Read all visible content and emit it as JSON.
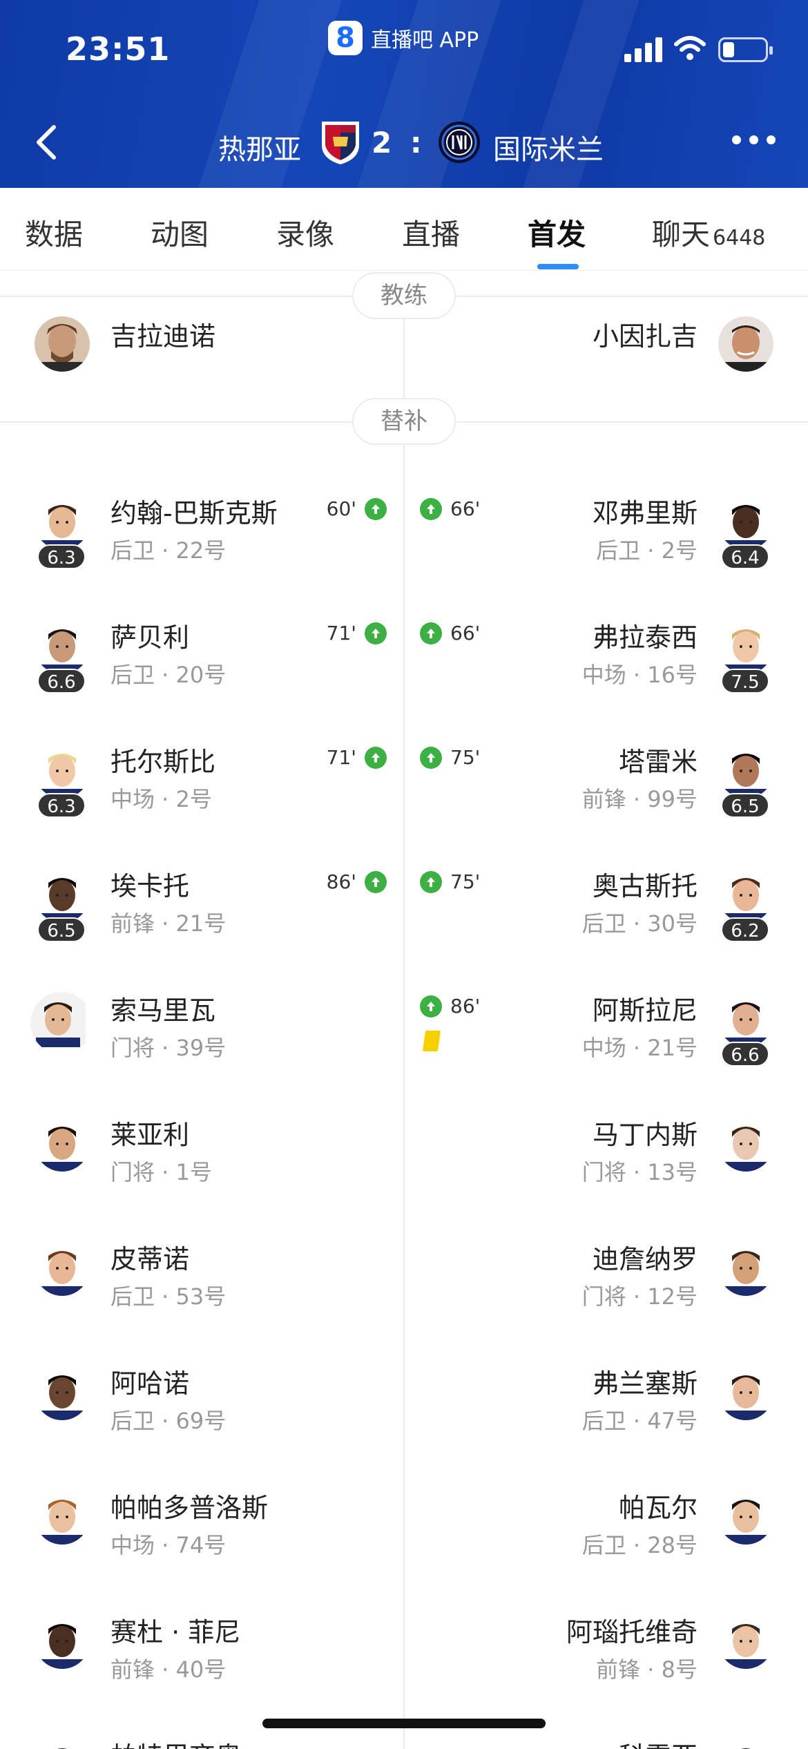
{
  "status_bar": {
    "time": "23:51",
    "app_name": "直播吧 APP",
    "app_logo_char": "8"
  },
  "match": {
    "home_team": "热那亚",
    "away_team": "国际米兰",
    "score": "2 : 2"
  },
  "tabs": [
    {
      "label": "数据"
    },
    {
      "label": "动图"
    },
    {
      "label": "录像"
    },
    {
      "label": "直播"
    },
    {
      "label": "首发",
      "active": true
    },
    {
      "label": "聊天",
      "count": "6448"
    }
  ],
  "sections": {
    "coach": "教练",
    "subs": "替补"
  },
  "coaches": {
    "home": "吉拉迪诺",
    "away": "小因扎吉"
  },
  "home_subs": [
    {
      "name": "约翰-巴斯克斯",
      "info": "后卫 · 22号",
      "rating": "6.3",
      "sub_time": "60'"
    },
    {
      "name": "萨贝利",
      "info": "后卫 · 20号",
      "rating": "6.6",
      "sub_time": "71'"
    },
    {
      "name": "托尔斯比",
      "info": "中场 · 2号",
      "rating": "6.3",
      "sub_time": "71'"
    },
    {
      "name": "埃卡托",
      "info": "前锋 · 21号",
      "rating": "6.5",
      "sub_time": "86'"
    },
    {
      "name": "索马里瓦",
      "info": "门将 · 39号"
    },
    {
      "name": "莱亚利",
      "info": "门将 · 1号"
    },
    {
      "name": "皮蒂诺",
      "info": "后卫 · 53号"
    },
    {
      "name": "阿哈诺",
      "info": "后卫 · 69号"
    },
    {
      "name": "帕帕多普洛斯",
      "info": "中场 · 74号"
    },
    {
      "name": "赛杜 · 菲尼",
      "info": "前锋 · 40号"
    },
    {
      "name": "帕特里齐奥"
    }
  ],
  "away_subs": [
    {
      "name": "邓弗里斯",
      "info": "后卫 · 2号",
      "rating": "6.4",
      "sub_time": "66'"
    },
    {
      "name": "弗拉泰西",
      "info": "中场 · 16号",
      "rating": "7.5",
      "sub_time": "66'"
    },
    {
      "name": "塔雷米",
      "info": "前锋 · 99号",
      "rating": "6.5",
      "sub_time": "75'"
    },
    {
      "name": "奥古斯托",
      "info": "后卫 · 30号",
      "rating": "6.2",
      "sub_time": "75'"
    },
    {
      "name": "阿斯拉尼",
      "info": "中场 · 21号",
      "rating": "6.6",
      "sub_time": "86'",
      "yellow_card": true
    },
    {
      "name": "马丁内斯",
      "info": "门将 · 13号"
    },
    {
      "name": "迪詹纳罗",
      "info": "门将 · 12号"
    },
    {
      "name": "弗兰塞斯",
      "info": "后卫 · 47号"
    },
    {
      "name": "帕瓦尔",
      "info": "后卫 · 28号"
    },
    {
      "name": "阿瑙托维奇",
      "info": "前锋 · 8号"
    },
    {
      "name": "科雷亚"
    }
  ],
  "colors": {
    "header_blue": "#1446b8",
    "tab_indicator": "#2f8cf0",
    "sub_green": "#3cb043",
    "yellow_card": "#f5d000",
    "rating_bg": "#333333"
  },
  "icons": {
    "back": "back-arrow-icon",
    "more": "more-dots-icon",
    "sub_in": "arrow-up-icon",
    "card": "yellow-card-icon"
  }
}
